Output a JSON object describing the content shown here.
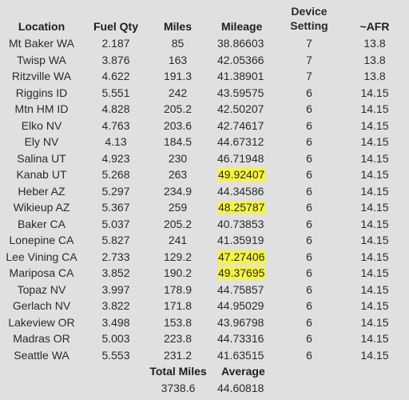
{
  "headers": {
    "location": "Location",
    "fuel_qty": "Fuel Qty",
    "miles": "Miles",
    "mileage": "Mileage",
    "device_setting_line1": "Device",
    "device_setting_line2": "Setting",
    "afr": "~AFR"
  },
  "highlight_color": "#f5f53c",
  "rows": [
    {
      "location": "Mt Baker WA",
      "fuel": "2.187",
      "miles": "85",
      "mileage": "38.86603",
      "device": "7",
      "afr": "13.8",
      "highlight": false
    },
    {
      "location": "Twisp WA",
      "fuel": "3.876",
      "miles": "163",
      "mileage": "42.05366",
      "device": "7",
      "afr": "13.8",
      "highlight": false
    },
    {
      "location": "Ritzville WA",
      "fuel": "4.622",
      "miles": "191.3",
      "mileage": "41.38901",
      "device": "7",
      "afr": "13.8",
      "highlight": false
    },
    {
      "location": "Riggins ID",
      "fuel": "5.551",
      "miles": "242",
      "mileage": "43.59575",
      "device": "6",
      "afr": "14.15",
      "highlight": false
    },
    {
      "location": "Mtn HM ID",
      "fuel": "4.828",
      "miles": "205.2",
      "mileage": "42.50207",
      "device": "6",
      "afr": "14.15",
      "highlight": false
    },
    {
      "location": "Elko NV",
      "fuel": "4.763",
      "miles": "203.6",
      "mileage": "42.74617",
      "device": "6",
      "afr": "14.15",
      "highlight": false
    },
    {
      "location": "Ely NV",
      "fuel": "4.13",
      "miles": "184.5",
      "mileage": "44.67312",
      "device": "6",
      "afr": "14.15",
      "highlight": false
    },
    {
      "location": "Salina UT",
      "fuel": "4.923",
      "miles": "230",
      "mileage": "46.71948",
      "device": "6",
      "afr": "14.15",
      "highlight": false
    },
    {
      "location": "Kanab UT",
      "fuel": "5.268",
      "miles": "263",
      "mileage": "49.92407",
      "device": "6",
      "afr": "14.15",
      "highlight": true
    },
    {
      "location": "Heber AZ",
      "fuel": "5.297",
      "miles": "234.9",
      "mileage": "44.34586",
      "device": "6",
      "afr": "14.15",
      "highlight": false
    },
    {
      "location": "Wikieup AZ",
      "fuel": "5.367",
      "miles": "259",
      "mileage": "48.25787",
      "device": "6",
      "afr": "14.15",
      "highlight": true
    },
    {
      "location": "Baker CA",
      "fuel": "5.037",
      "miles": "205.2",
      "mileage": "40.73853",
      "device": "6",
      "afr": "14.15",
      "highlight": false
    },
    {
      "location": "Lonepine CA",
      "fuel": "5.827",
      "miles": "241",
      "mileage": "41.35919",
      "device": "6",
      "afr": "14.15",
      "highlight": false
    },
    {
      "location": "Lee Vining CA",
      "fuel": "2.733",
      "miles": "129.2",
      "mileage": "47.27406",
      "device": "6",
      "afr": "14.15",
      "highlight": true
    },
    {
      "location": "Mariposa CA",
      "fuel": "3.852",
      "miles": "190.2",
      "mileage": "49.37695",
      "device": "6",
      "afr": "14.15",
      "highlight": true
    },
    {
      "location": "Topaz NV",
      "fuel": "3.997",
      "miles": "178.9",
      "mileage": "44.75857",
      "device": "6",
      "afr": "14.15",
      "highlight": false
    },
    {
      "location": "Gerlach NV",
      "fuel": "3.822",
      "miles": "171.8",
      "mileage": "44.95029",
      "device": "6",
      "afr": "14.15",
      "highlight": false
    },
    {
      "location": "Lakeview OR",
      "fuel": "3.498",
      "miles": "153.8",
      "mileage": "43.96798",
      "device": "6",
      "afr": "14.15",
      "highlight": false
    },
    {
      "location": "Madras OR",
      "fuel": "5.003",
      "miles": "223.8",
      "mileage": "44.73316",
      "device": "6",
      "afr": "14.15",
      "highlight": false
    },
    {
      "location": "Seattle WA",
      "fuel": "5.553",
      "miles": "231.2",
      "mileage": "41.63515",
      "device": "6",
      "afr": "14.15",
      "highlight": false
    }
  ],
  "summary": {
    "total_miles_label": "Total Miles",
    "total_miles_value": "3738.6",
    "average_label": "Average",
    "average_value": "44.60818"
  }
}
